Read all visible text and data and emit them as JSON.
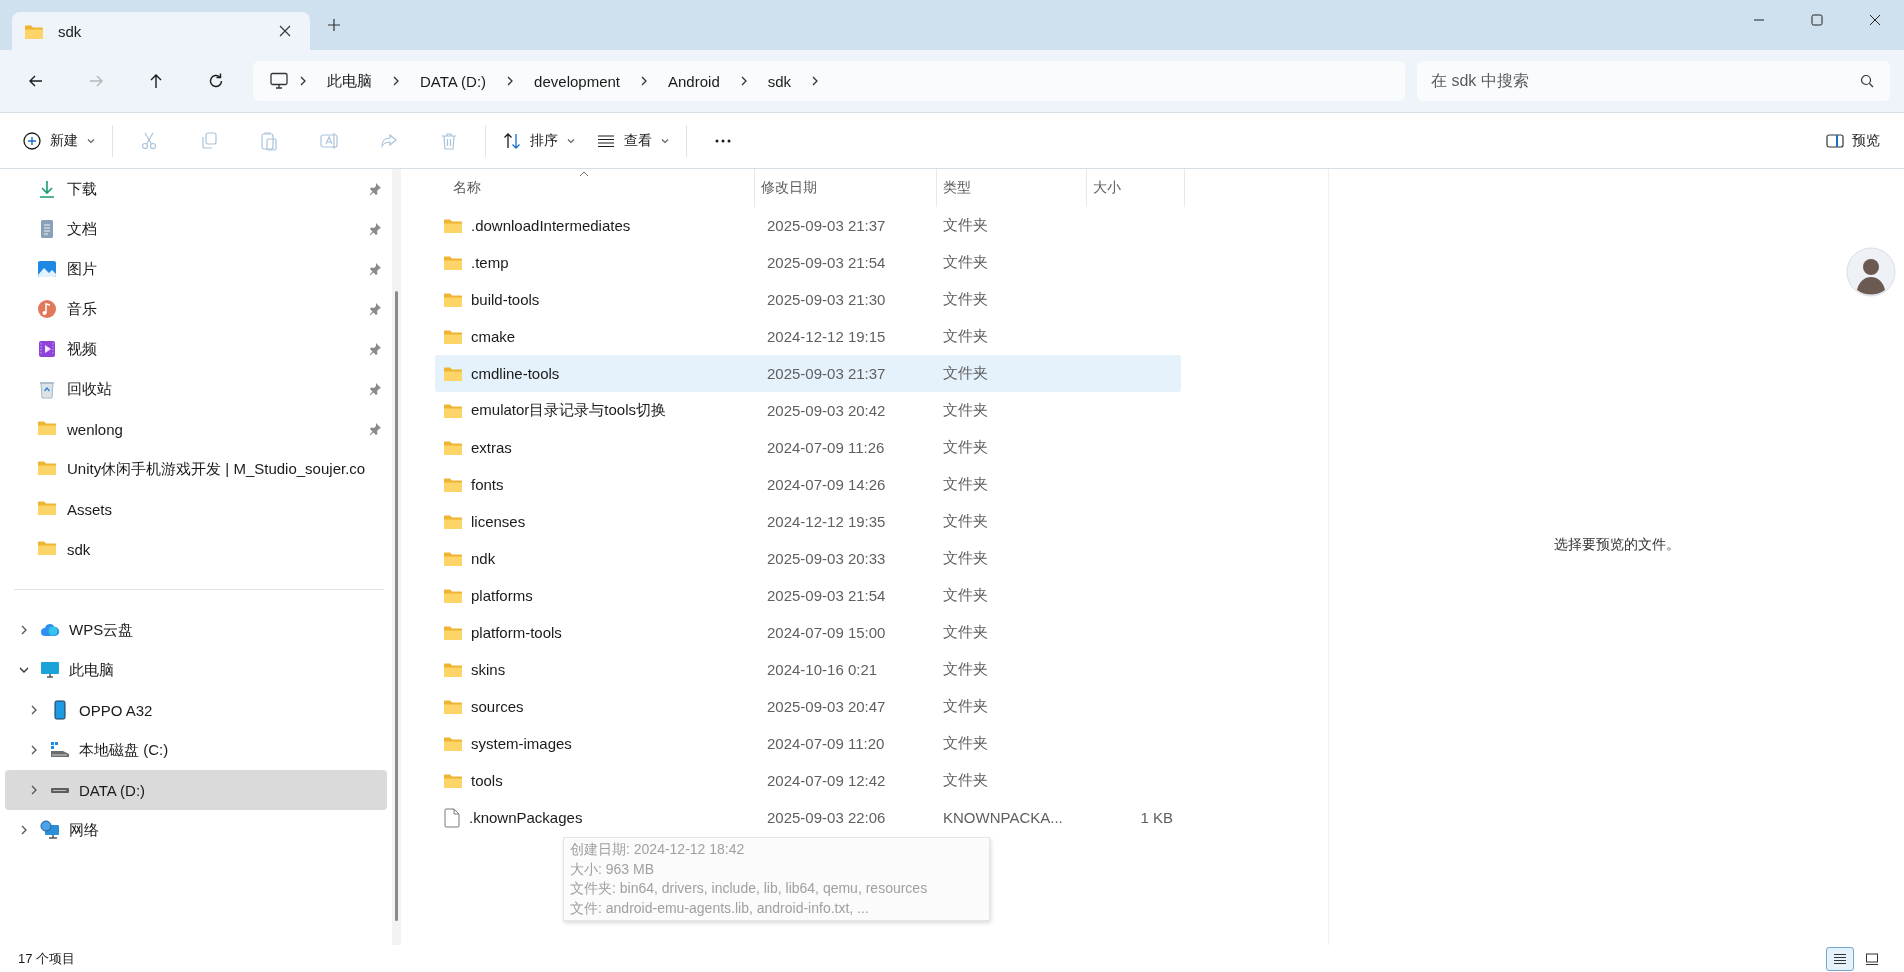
{
  "window": {
    "tab": {
      "title": "sdk",
      "selected": true
    }
  },
  "nav": [
    {
      "kind": "back",
      "disabled": false
    },
    {
      "kind": "forward",
      "disabled": true
    },
    {
      "kind": "up",
      "disabled": false
    },
    {
      "kind": "refresh",
      "disabled": false
    }
  ],
  "address_bar": {
    "crumbs": [
      "此电脑",
      "DATA (D:)",
      "development",
      "Android",
      "sdk"
    ]
  },
  "search": {
    "placeholder": "在 sdk 中搜索"
  },
  "toolbar": {
    "items": [
      {
        "kind": "new",
        "label": "新建",
        "dropdown": true,
        "disabled": false
      },
      {
        "kind": "cut",
        "disabled": true
      },
      {
        "kind": "copy",
        "disabled": true
      },
      {
        "kind": "paste",
        "disabled": true
      },
      {
        "kind": "rename",
        "disabled": true
      },
      {
        "kind": "share",
        "disabled": true
      },
      {
        "kind": "delete",
        "disabled": true
      },
      {
        "kind": "sort",
        "label": "排序",
        "dropdown": true,
        "disabled": false
      },
      {
        "kind": "view",
        "label": "查看",
        "dropdown": true,
        "disabled": false
      },
      {
        "kind": "more",
        "disabled": false
      }
    ],
    "preview": {
      "label": "预览"
    }
  },
  "sidebar": {
    "quick_access": [
      {
        "kind": "download",
        "label": "下载",
        "pinned": true
      },
      {
        "kind": "document",
        "label": "文档",
        "pinned": true
      },
      {
        "kind": "pictures",
        "label": "图片",
        "pinned": true
      },
      {
        "kind": "music",
        "label": "音乐",
        "pinned": true
      },
      {
        "kind": "video",
        "label": "视频",
        "pinned": true
      },
      {
        "kind": "recycle",
        "label": "回收站",
        "pinned": true
      },
      {
        "kind": "folder",
        "label": "wenlong",
        "pinned": true
      },
      {
        "kind": "folder",
        "label": "Unity休闲手机游戏开发 | M_Studio_soujer.co",
        "pinned": false
      },
      {
        "kind": "folder",
        "label": "Assets",
        "pinned": false
      },
      {
        "kind": "folder",
        "label": "sdk",
        "pinned": false
      }
    ],
    "tree": [
      {
        "kind": "cloud",
        "label": "WPS云盘",
        "expanded": false,
        "selected": false
      },
      {
        "kind": "pc",
        "label": "此电脑",
        "expanded": true,
        "selected": false,
        "children": [
          {
            "kind": "phone",
            "label": "OPPO A32",
            "expanded": false,
            "selected": false
          },
          {
            "kind": "system-drive",
            "label": "本地磁盘 (C:)",
            "expanded": false,
            "selected": false
          },
          {
            "kind": "drive",
            "label": "DATA (D:)",
            "expanded": false,
            "selected": true
          }
        ]
      },
      {
        "kind": "network",
        "label": "网络",
        "expanded": false,
        "selected": false
      }
    ]
  },
  "file_list": {
    "columns": [
      {
        "label": "名称",
        "sorted": true
      },
      {
        "label": "修改日期",
        "sorted": false
      },
      {
        "label": "类型",
        "sorted": false
      },
      {
        "label": "大小",
        "sorted": false
      }
    ],
    "rows": [
      {
        "kind": "folder",
        "name": ".downloadIntermediates",
        "modified": "2025-09-03 21:37",
        "type": "文件夹",
        "highlighted": false
      },
      {
        "kind": "folder",
        "name": ".temp",
        "modified": "2025-09-03 21:54",
        "type": "文件夹",
        "highlighted": false
      },
      {
        "kind": "folder",
        "name": "build-tools",
        "modified": "2025-09-03 21:30",
        "type": "文件夹",
        "highlighted": false
      },
      {
        "kind": "folder",
        "name": "cmake",
        "modified": "2024-12-12 19:15",
        "type": "文件夹",
        "highlighted": false
      },
      {
        "kind": "folder",
        "name": "cmdline-tools",
        "modified": "2025-09-03 21:37",
        "type": "文件夹",
        "highlighted": true
      },
      {
        "kind": "folder",
        "name": "emulator目录记录与tools切换",
        "modified": "2025-09-03 20:42",
        "type": "文件夹",
        "highlighted": false
      },
      {
        "kind": "folder",
        "name": "extras",
        "modified": "2024-07-09 11:26",
        "type": "文件夹",
        "highlighted": false
      },
      {
        "kind": "folder",
        "name": "fonts",
        "modified": "2024-07-09 14:26",
        "type": "文件夹",
        "highlighted": false
      },
      {
        "kind": "folder",
        "name": "licenses",
        "modified": "2024-12-12 19:35",
        "type": "文件夹",
        "highlighted": false
      },
      {
        "kind": "folder",
        "name": "ndk",
        "modified": "2025-09-03 20:33",
        "type": "文件夹",
        "highlighted": false
      },
      {
        "kind": "folder",
        "name": "platforms",
        "modified": "2025-09-03 21:54",
        "type": "文件夹",
        "highlighted": false
      },
      {
        "kind": "folder",
        "name": "platform-tools",
        "modified": "2024-07-09 15:00",
        "type": "文件夹",
        "highlighted": false
      },
      {
        "kind": "folder",
        "name": "skins",
        "modified": "2024-10-16 0:21",
        "type": "文件夹",
        "highlighted": false
      },
      {
        "kind": "folder",
        "name": "sources",
        "modified": "2025-09-03 20:47",
        "type": "文件夹",
        "highlighted": false
      },
      {
        "kind": "folder",
        "name": "system-images",
        "modified": "2024-07-09 11:20",
        "type": "文件夹",
        "highlighted": false
      },
      {
        "kind": "folder",
        "name": "tools",
        "modified": "2024-07-09 12:42",
        "type": "文件夹",
        "highlighted": false
      },
      {
        "kind": "file",
        "name": ".knownPackages",
        "modified": "2025-09-03 22:06",
        "type": "KNOWNPACKA...",
        "size": "1 KB",
        "highlighted": false
      }
    ],
    "tooltip": [
      "创建日期: 2024-12-12 18:42",
      "大小: 963 MB",
      "文件夹: bin64, drivers, include, lib, lib64, qemu, resources",
      "文件: android-emu-agents.lib, android-info.txt, ..."
    ]
  },
  "preview_pane": {
    "message": "选择要预览的文件。"
  },
  "status_bar": {
    "count": "17 个项目",
    "views": [
      {
        "kind": "details",
        "selected": true
      },
      {
        "kind": "tiles",
        "selected": false
      }
    ]
  }
}
